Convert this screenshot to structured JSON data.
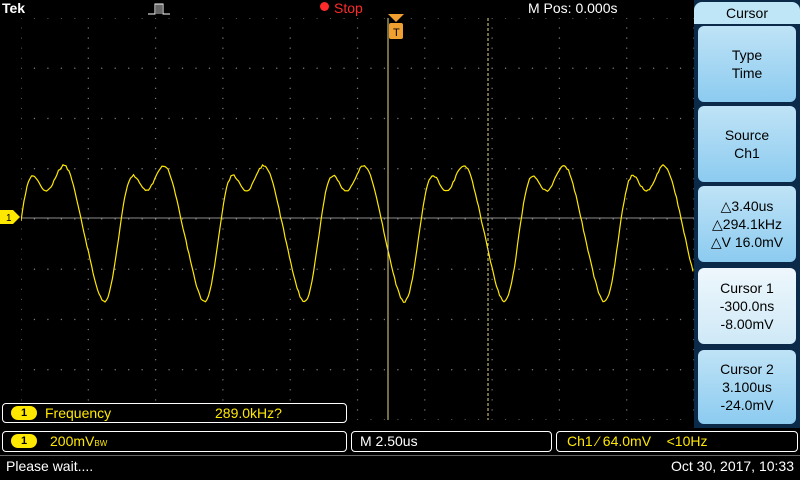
{
  "topbar": {
    "brand": "Tek",
    "run_state": "Stop",
    "mpos": "M Pos: 0.000s"
  },
  "menu": {
    "title": "Cursor",
    "buttons": [
      {
        "line1": "Type",
        "line2": "Time",
        "line3": ""
      },
      {
        "line1": "Source",
        "line2": "Ch1",
        "line3": ""
      },
      {
        "line1": "△3.40us",
        "line2": "△294.1kHz",
        "line3": "△V 16.0mV"
      },
      {
        "line1": "Cursor 1",
        "line2": "-300.0ns",
        "line3": "-8.00mV"
      },
      {
        "line1": "Cursor 2",
        "line2": "3.100us",
        "line3": "-24.0mV"
      }
    ]
  },
  "measurement": {
    "channel": "1",
    "label": "Frequency",
    "value": "289.0kHz?"
  },
  "channel_settings": {
    "channel": "1",
    "volts_div": "200mV",
    "bw_mark": "BW"
  },
  "timebase": "M 2.50us",
  "trigger": {
    "text": "Ch1 ⁄ 64.0mV",
    "freq": "<10Hz"
  },
  "ch1_marker": "1",
  "trig_marker": "T",
  "status": {
    "message": "Please wait....",
    "datetime": "Oct 30, 2017, 10:33"
  },
  "colors": {
    "trace": "#ffe800",
    "menu_bg": "#0b2a4a",
    "menu_button": "#a8d8f2",
    "stop": "#ff2a2a"
  }
}
